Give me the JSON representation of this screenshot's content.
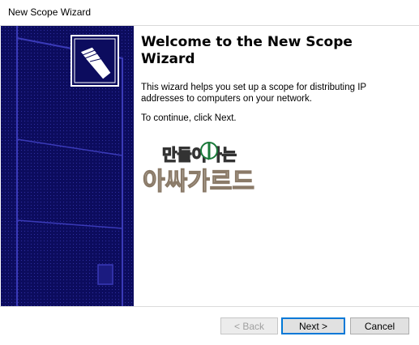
{
  "window": {
    "title": "New Scope Wizard"
  },
  "content": {
    "heading": "Welcome to the New Scope Wizard",
    "paragraph1": "This wizard helps you set up a scope for distributing IP addresses to computers on your network.",
    "paragraph2": "To continue, click Next."
  },
  "buttons": {
    "back_label": "< Back",
    "next_label": "Next >",
    "cancel_label": "Cancel",
    "back_enabled": false
  },
  "watermark": {
    "line1": "만들어가는",
    "line2": "아싸가르드"
  },
  "colors": {
    "banner_navy": "#0c0c5e",
    "banner_dots": "#2f2fa0",
    "next_border": "#0078d7"
  },
  "icons": {
    "banner_icon": "folders-icon"
  }
}
